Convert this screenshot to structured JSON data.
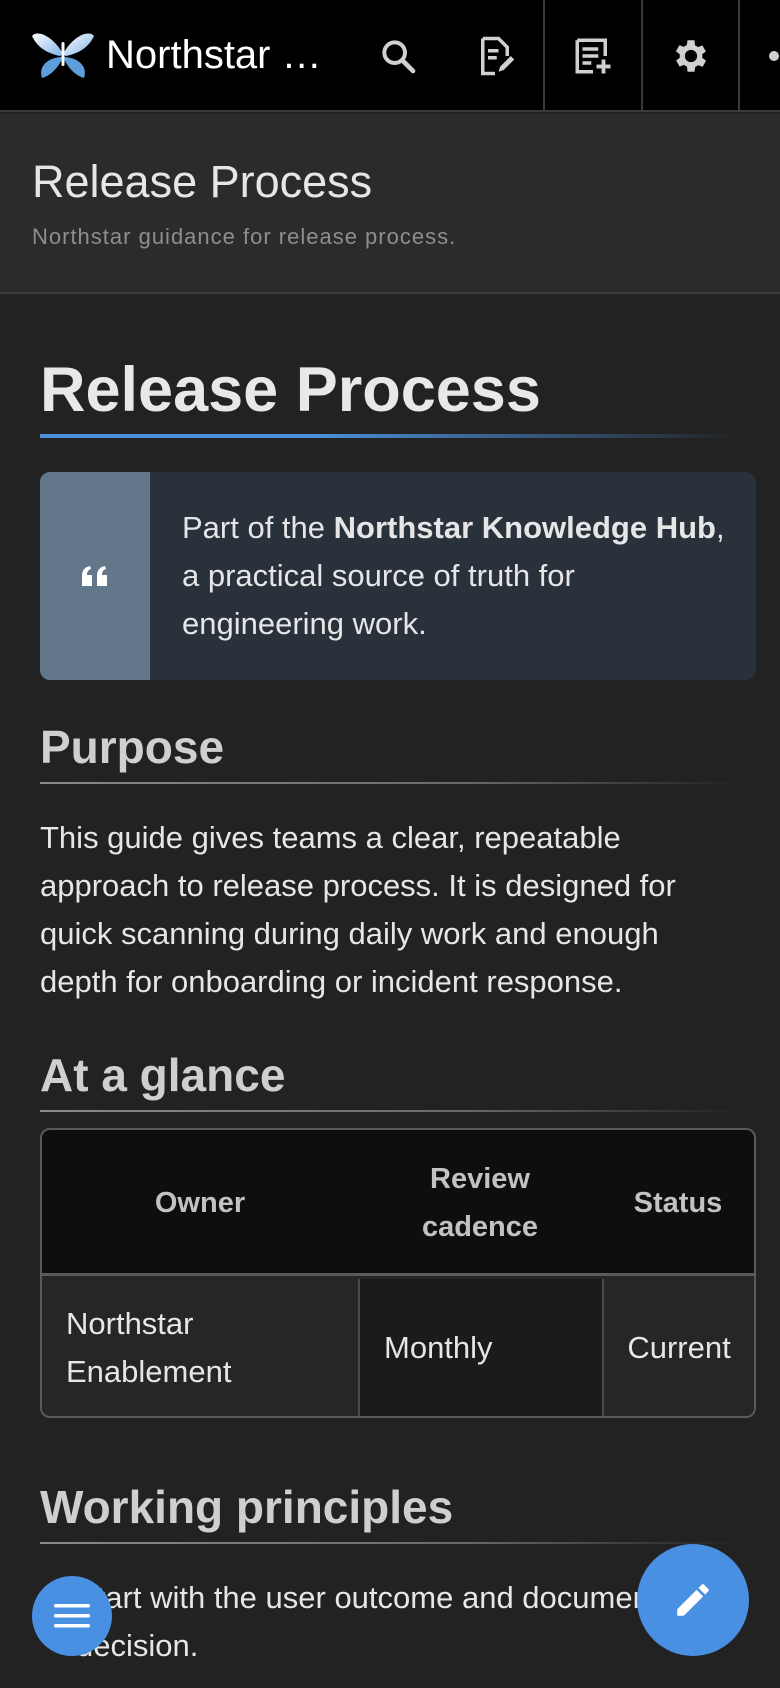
{
  "app": {
    "title": "Northstar …"
  },
  "toolbar": {
    "icons": [
      "search-icon",
      "edit-page-icon",
      "new-page-icon",
      "settings-icon",
      "account-icon"
    ]
  },
  "page_header": {
    "title": "Release Process",
    "subtitle": "Northstar guidance for release process."
  },
  "article": {
    "title": "Release Process",
    "callout": {
      "prefix": "Part of the ",
      "bold": "Northstar Knowledge Hub",
      "suffix": ", a practical source of truth for engineering work."
    },
    "purpose": {
      "heading": "Purpose",
      "text": "This guide gives teams a clear, repeatable approach to release process. It is designed for quick scanning during daily work and enough depth for onboarding or incident response."
    },
    "glance": {
      "heading": "At a glance",
      "columns": [
        "Owner",
        "Review cadence",
        "Status"
      ],
      "rows": [
        [
          "Northstar Enablement",
          "Monthly",
          "Current"
        ]
      ]
    },
    "principles": {
      "heading": "Working principles",
      "first_item": "Start with the user outcome and document the decision."
    }
  },
  "colors": {
    "accent": "#4a90e2",
    "background": "#222222",
    "topbar": "#000000",
    "callout_bar": "#62788a",
    "callout_bg": "#29313b"
  }
}
